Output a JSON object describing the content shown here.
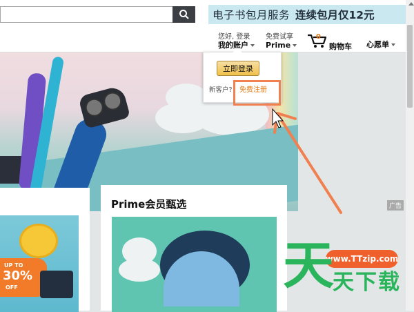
{
  "search": {
    "placeholder": ""
  },
  "promo": {
    "text1": "电子书包月服务",
    "text2": "连续包月仅12元"
  },
  "nav": {
    "greeting": "您好, 登录",
    "account": "我的账户",
    "prime_top": "免费试享",
    "prime": "Prime",
    "cart_count": "0",
    "cart": "购物车",
    "wishlist": "心愿单"
  },
  "popup": {
    "signin": "立即登录",
    "new_customer": "新客户?",
    "register": "免费注册"
  },
  "ad": {
    "label": "广告"
  },
  "card2": {
    "title": "Prime会员甄选"
  },
  "card1": {
    "badge_up": "UP TO",
    "badge_pct": "30%",
    "badge_off": "OFF"
  },
  "watermark": {
    "url": "www.TTzip.com",
    "big": "天",
    "small": "天下载"
  },
  "colors": {
    "accent": "#e47911",
    "highlight": "#f08050",
    "watermark": "#2ab55c"
  }
}
